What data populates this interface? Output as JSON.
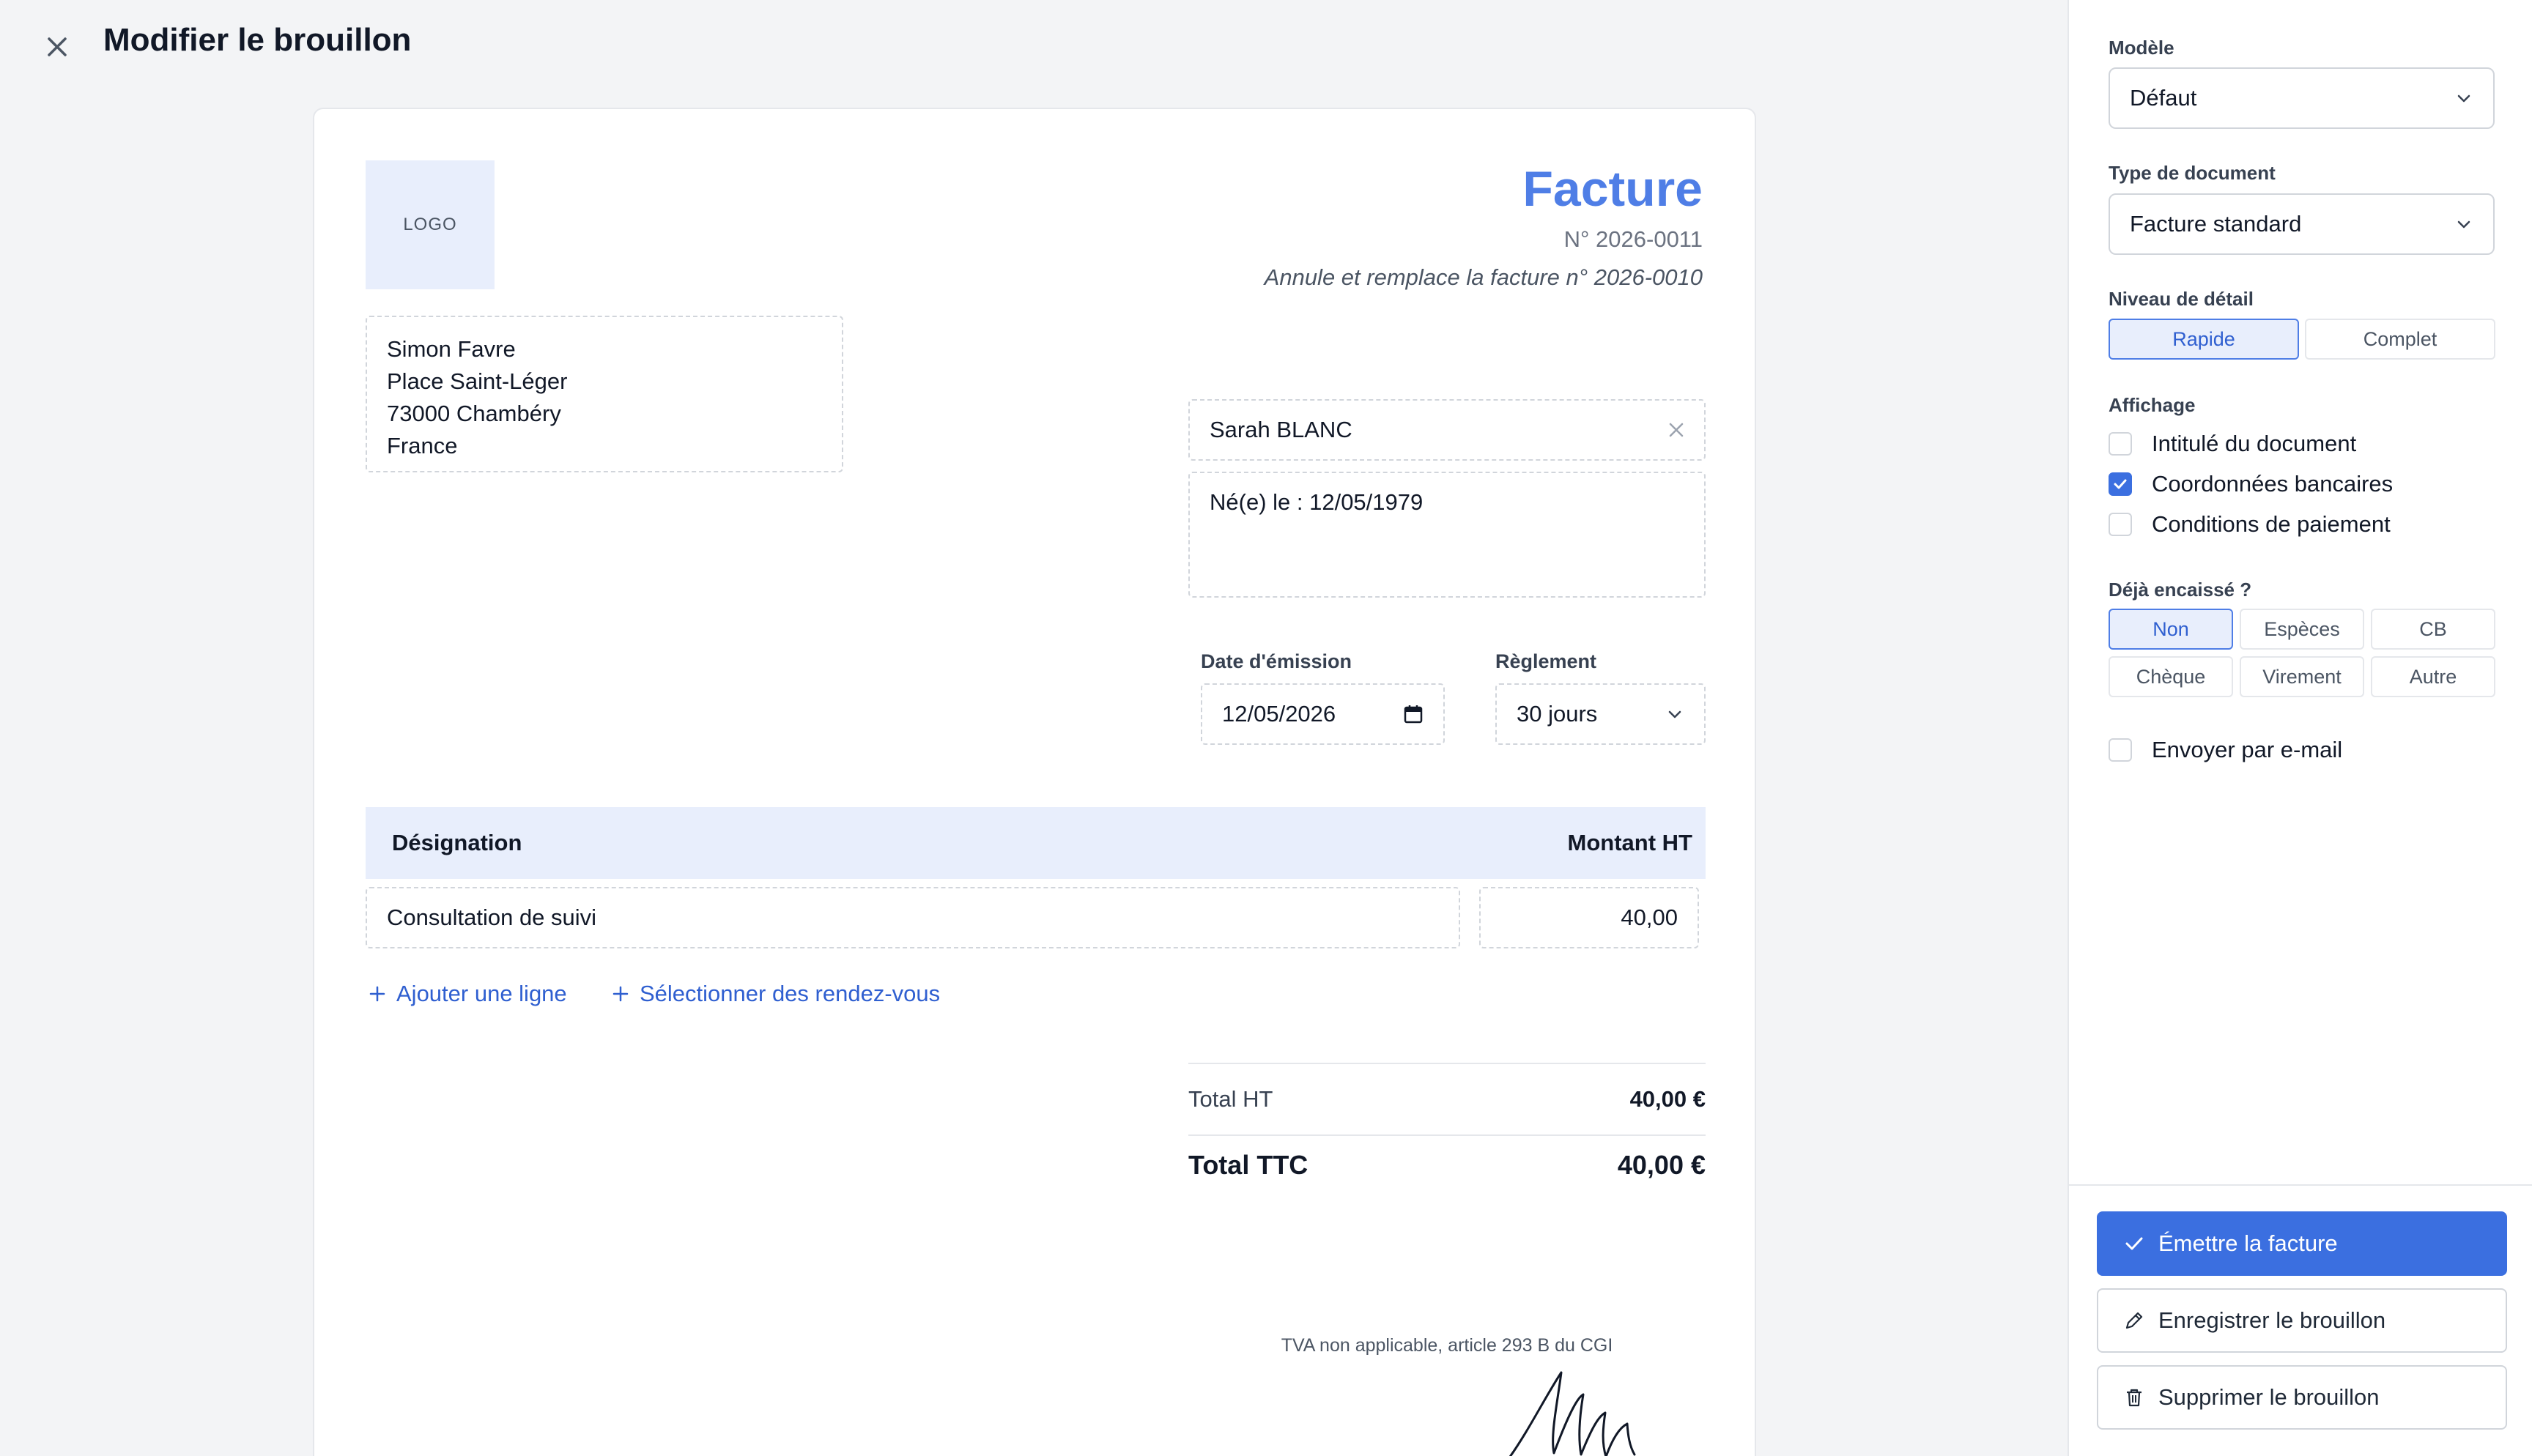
{
  "header": {
    "title": "Modifier le brouillon"
  },
  "invoice": {
    "logo_text": "LOGO",
    "doc_title": "Facture",
    "doc_number": "N° 2026-0011",
    "replaces": "Annule et remplace la facture n° 2026-0010",
    "issuer": {
      "name": "Simon Favre",
      "street": "Place Saint-Léger",
      "city": "73000 Chambéry",
      "country": "France"
    },
    "client": {
      "name": "Sarah BLANC",
      "extra": "Né(e) le : 12/05/1979"
    },
    "date_label": "Date d'émission",
    "date_value": "12/05/2026",
    "payment_label": "Règlement",
    "payment_value": "30 jours",
    "table": {
      "col_designation": "Désignation",
      "col_amount": "Montant HT",
      "rows": [
        {
          "designation": "Consultation de suivi",
          "amount": "40,00"
        }
      ]
    },
    "add_line_label": "Ajouter une ligne",
    "select_appointments_label": "Sélectionner des rendez-vous",
    "totals": {
      "ht_label": "Total HT",
      "ht_value": "40,00 €",
      "ttc_label": "Total TTC",
      "ttc_value": "40,00 €"
    },
    "tva_note": "TVA non applicable, article 293 B du CGI"
  },
  "sidebar": {
    "model_label": "Modèle",
    "model_value": "Défaut",
    "doc_type_label": "Type de document",
    "doc_type_value": "Facture standard",
    "detail_label": "Niveau de détail",
    "detail_options": [
      "Rapide",
      "Complet"
    ],
    "detail_selected": "Rapide",
    "display_label": "Affichage",
    "display_options": [
      {
        "label": "Intitulé du document",
        "checked": false
      },
      {
        "label": "Coordonnées bancaires",
        "checked": true
      },
      {
        "label": "Conditions de paiement",
        "checked": false
      }
    ],
    "paid_label": "Déjà encaissé ?",
    "paid_options": [
      "Non",
      "Espèces",
      "CB",
      "Chèque",
      "Virement",
      "Autre"
    ],
    "paid_selected": "Non",
    "email_label": "Envoyer par e-mail",
    "email_checked": false,
    "actions": {
      "issue": "Émettre la facture",
      "save": "Enregistrer le brouillon",
      "delete": "Supprimer le brouillon"
    }
  },
  "colors": {
    "accent": "#3b6fe0",
    "title_blue": "#4f7ee6",
    "link_blue": "#2f5fd0",
    "table_header_bg": "#e8eefc"
  }
}
